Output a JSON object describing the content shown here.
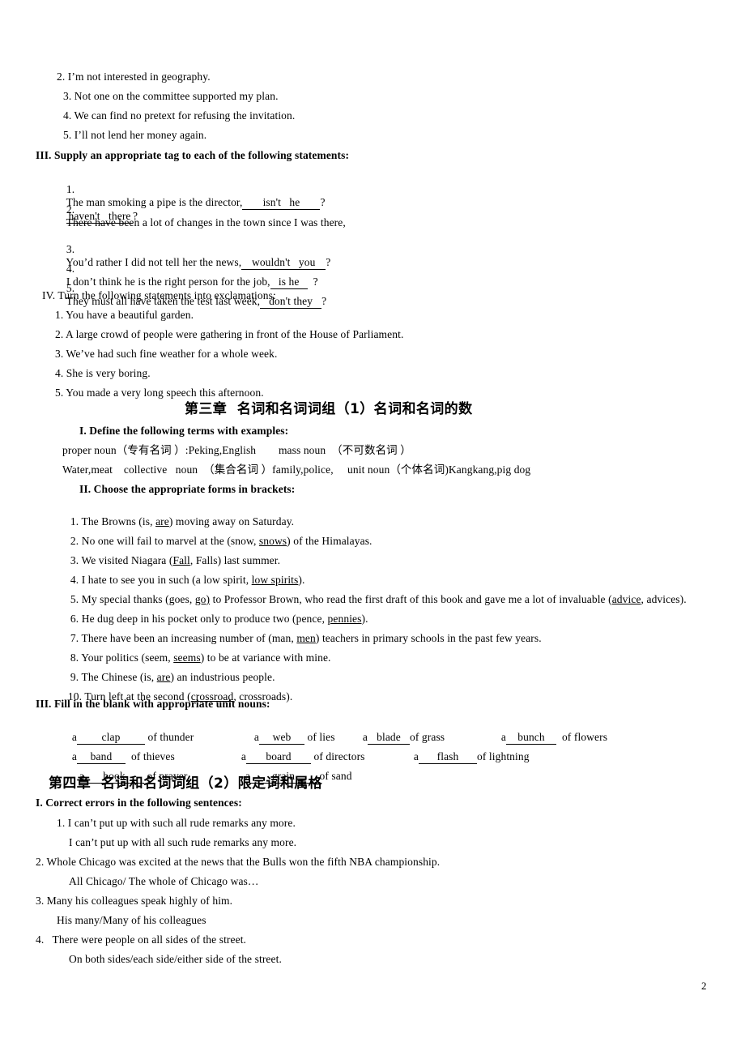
{
  "document": {
    "page_number": "2",
    "background": "#ffffff",
    "text_color": "#000000"
  },
  "section_tag_questions": {
    "prev_items": [
      "2. I’m not interested in geography.",
      "3. Not one on the committee supported my plan.",
      "4. We can find no pretext for refusing the invitation.",
      "5. I’ll not lend her money again."
    ],
    "heading": "III. Supply an appropriate tag to each of the following statements:",
    "items": [
      {
        "number": "1.",
        "text_before": "The man smoking a pipe is the director,",
        "answer": "isn't   he",
        "text_after": "?"
      },
      {
        "number": "2.",
        "text_before": "There have been a lot of changes in the town since I was there,",
        "answer": "haven't   there",
        "text_after": "?",
        "wraps": true
      },
      {
        "number": "3.",
        "text_before": "You’d rather I did not tell her the news,",
        "answer": "wouldn't   you",
        "text_after": "?"
      },
      {
        "number": "4.",
        "text_before": "I don’t think he is the right person for the job,",
        "answer": "is he",
        "text_after": "?"
      },
      {
        "number": "5.",
        "text_before": "They must all have taken the test last week,",
        "answer": "don't they",
        "text_after": "?"
      }
    ]
  },
  "section_exclamations": {
    "heading": "IV. Turn the following statements into exclamations:",
    "items": [
      "1. You have a beautiful garden.",
      "2. A large crowd of people were gathering in front of the House of Parliament.",
      "3. We’ve had such fine weather for a whole week.",
      "4. She is very boring.",
      "5. You made a very long speech this afternoon."
    ]
  },
  "chapter_three": {
    "title": "第三章  名词和名词词组（1）名词和名词的数",
    "part_one": {
      "heading": "I. Define the following terms with examples:",
      "line1": "proper noun（专有名词 ）:Peking,English        mass noun  （不可数名词 ）",
      "line2": "Water,meat    collective   noun  （集合名词 ）family,police,     unit noun（个体名词)Kangkang,pig dog"
    },
    "part_two": {
      "heading": "II. Choose the appropriate forms in brackets:",
      "items": [
        {
          "number": "1.",
          "pre": "The Browns (is, ",
          "answer": "are",
          "post": ") moving away on Saturday."
        },
        {
          "number": "2.",
          "pre": "No one will fail to marvel at the (snow, ",
          "answer": "snows",
          "post": ") of the Himalayas."
        },
        {
          "number": "3.",
          "pre": "We visited Niagara (",
          "answer": "Fall",
          "post": ", Falls) last summer."
        },
        {
          "number": "4.",
          "pre": "I hate to see you in such (a low spirit, ",
          "answer": "low spirits",
          "post": ")."
        },
        {
          "number": "5.",
          "pre": "My special thanks (goes, ",
          "answer": "go)",
          "post": " to Professor Brown, who read the first draft of this book and gave me a lot of invaluable (",
          "answer2": "advice",
          "post2": ", advices)."
        },
        {
          "number": "6.",
          "pre": "He dug deep in his pocket only to produce two (pence, ",
          "answer": "pennies",
          "post": ")."
        },
        {
          "number": "7.",
          "pre": "There have been an increasing number of (man, ",
          "answer": "men",
          "post": ") teachers in primary schools in the past few years."
        },
        {
          "number": "8.",
          "pre": "Your politics (seem, ",
          "answer": "seems",
          "post": ") to be at variance with mine."
        },
        {
          "number": "9.",
          "pre": "The Chinese (is, ",
          "answer": "are",
          "post": ") an industrious people."
        },
        {
          "number": "10.",
          "pre": "Turn left at the second (",
          "answer": "crossroad",
          "post": ", crossroads)."
        }
      ]
    },
    "part_three": {
      "heading": "III. Fill in the blank with appropriate unit nouns:",
      "rows": [
        [
          {
            "article": "a",
            "answer": "clap",
            "tail": "of thunder"
          },
          {
            "article": "a",
            "answer": "web",
            "tail": "of lies"
          },
          {
            "article": "a",
            "answer": "blade",
            "tail": "of grass"
          },
          {
            "article": "a",
            "answer": "bunch",
            "tail": "of flowers"
          }
        ],
        [
          {
            "article": "a",
            "answer": "band",
            "tail": "of thieves"
          },
          {
            "article": "a",
            "answer": "board",
            "tail": "of directors"
          },
          {
            "article": "a",
            "answer": "flash",
            "tail": "of lightning"
          }
        ],
        [
          {
            "article": "a",
            "answer": "book",
            "tail": "of prayer"
          },
          {
            "article": "a",
            "answer": "grain",
            "tail": "of sand"
          }
        ]
      ]
    }
  },
  "chapter_four": {
    "title": "第四章  名词和名词词组（2）限定词和属格",
    "part_one": {
      "heading": "I. Correct errors in the following sentences:",
      "items": [
        {
          "question": "1. I can’t put up with such all rude remarks any more.",
          "answer": "I can’t put up with all such rude remarks any more."
        },
        {
          "question": "2. Whole Chicago was excited at the news that the Bulls won the fifth NBA championship.",
          "answer": "All Chicago/ The whole of Chicago was…"
        },
        {
          "question": "3. Many his colleagues speak highly of him.",
          "answer": "His many/Many of his colleagues"
        },
        {
          "question": "4.   There were people on all sides of the street.",
          "answer": "On both sides/each side/either side of the street."
        }
      ]
    }
  }
}
